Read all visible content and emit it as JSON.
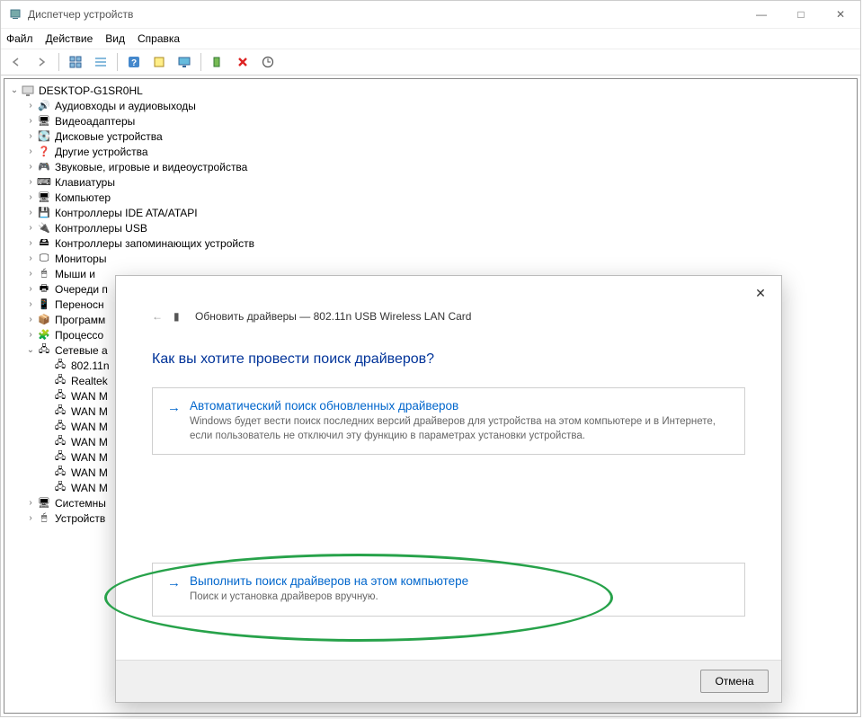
{
  "window": {
    "title": "Диспетчер устройств",
    "controls": {
      "min": "—",
      "max": "□",
      "close": "✕"
    }
  },
  "menubar": [
    "Файл",
    "Действие",
    "Вид",
    "Справка"
  ],
  "toolbar_icons": [
    "back",
    "forward",
    "|",
    "grid1",
    "grid2",
    "|",
    "help",
    "monitor",
    "display",
    "|",
    "server",
    "x-red",
    "target"
  ],
  "tree": {
    "root": "DESKTOP-G1SR0HL",
    "nodes": [
      {
        "label": "Аудиовходы и аудиовыходы",
        "icon": "audio"
      },
      {
        "label": "Видеоадаптеры",
        "icon": "video"
      },
      {
        "label": "Дисковые устройства",
        "icon": "disk"
      },
      {
        "label": "Другие устройства",
        "icon": "other"
      },
      {
        "label": "Звуковые, игровые и видеоустройства",
        "icon": "sound"
      },
      {
        "label": "Клавиатуры",
        "icon": "keyboard"
      },
      {
        "label": "Компьютер",
        "icon": "computer"
      },
      {
        "label": "Контроллеры IDE ATA/ATAPI",
        "icon": "ide"
      },
      {
        "label": "Контроллеры USB",
        "icon": "usb"
      },
      {
        "label": "Контроллеры запоминающих устройств",
        "icon": "storage"
      },
      {
        "label": "Мониторы",
        "icon": "monitor"
      },
      {
        "label": "Мыши и ",
        "icon": "mouse"
      },
      {
        "label": "Очереди п",
        "icon": "printer"
      },
      {
        "label": "Переносн",
        "icon": "portable"
      },
      {
        "label": "Программ",
        "icon": "software"
      },
      {
        "label": "Процессо",
        "icon": "cpu"
      }
    ],
    "network": {
      "label": "Сетевые а",
      "children": [
        {
          "label": "802.11n"
        },
        {
          "label": "Realtek"
        },
        {
          "label": "WAN M"
        },
        {
          "label": "WAN M"
        },
        {
          "label": "WAN M"
        },
        {
          "label": "WAN M"
        },
        {
          "label": "WAN M"
        },
        {
          "label": "WAN M"
        },
        {
          "label": "WAN M"
        }
      ]
    },
    "tail": [
      {
        "label": "Системны",
        "icon": "system"
      },
      {
        "label": "Устройств",
        "icon": "device"
      }
    ]
  },
  "dialog": {
    "breadcrumb_prefix": "Обновить драйверы —",
    "breadcrumb_device": "802.11n USB Wireless LAN Card",
    "question": "Как вы хотите провести поиск драйверов?",
    "opt1_title": "Автоматический поиск обновленных драйверов",
    "opt1_desc": "Windows будет вести поиск последних версий драйверов для устройства на этом компьютере и в Интернете, если пользователь не отключил эту функцию в параметрах установки устройства.",
    "opt2_title": "Выполнить поиск драйверов на этом компьютере",
    "opt2_desc": "Поиск и установка драйверов вручную.",
    "cancel": "Отмена"
  }
}
